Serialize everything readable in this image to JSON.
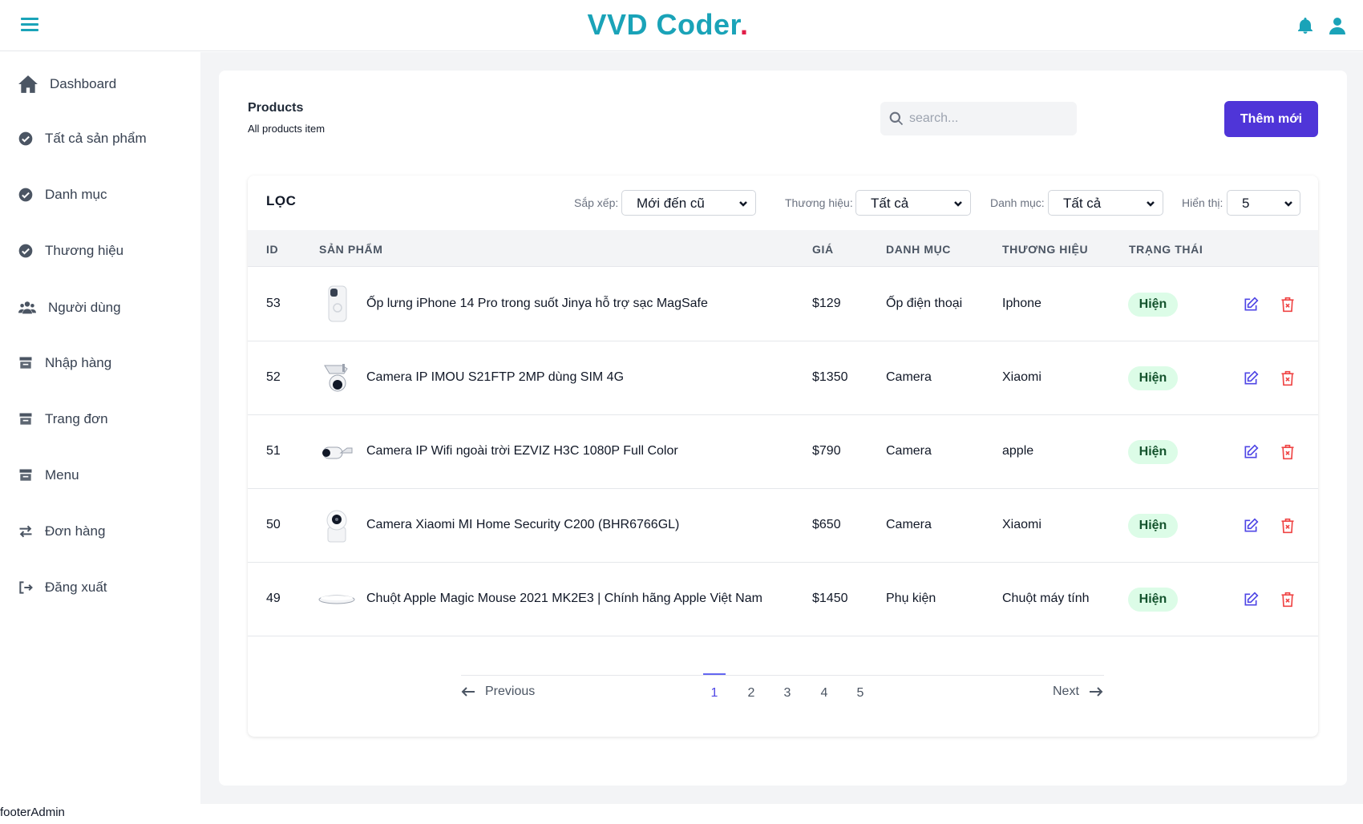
{
  "header": {
    "brand": "VVD Coder",
    "brand_dot": ".",
    "icons": [
      "menu-icon",
      "bell-icon",
      "user-icon"
    ]
  },
  "sidebar": {
    "items": [
      {
        "label": "Dashboard",
        "icon": "home-icon"
      },
      {
        "label": "Tất cả sản phẩm",
        "icon": "check-circle-icon"
      },
      {
        "label": "Danh mục",
        "icon": "check-circle-icon"
      },
      {
        "label": "Thương hiệu",
        "icon": "check-circle-icon"
      },
      {
        "label": "Người dùng",
        "icon": "users-icon"
      },
      {
        "label": "Nhập hàng",
        "icon": "store-icon"
      },
      {
        "label": "Trang đơn",
        "icon": "store-icon"
      },
      {
        "label": "Menu",
        "icon": "store-icon"
      },
      {
        "label": "Đơn hàng",
        "icon": "exchange-icon"
      },
      {
        "label": "Đăng xuất",
        "icon": "logout-icon"
      }
    ]
  },
  "page": {
    "title": "Products",
    "subtitle": "All products item",
    "search_placeholder": "search...",
    "add_button": "Thêm mới"
  },
  "filters": {
    "title": "LỌC",
    "sort_label": "Sắp xếp:",
    "sort_value": "Mới đến cũ",
    "brand_label": "Thương hiệu:",
    "brand_value": "Tất cả",
    "category_label": "Danh mục:",
    "category_value": "Tất cả",
    "show_label": "Hiển thị:",
    "show_value": "5"
  },
  "table": {
    "columns": [
      "ID",
      "SẢN PHẨM",
      "GIÁ",
      "DANH MỤC",
      "THƯƠNG HIỆU",
      "TRẠNG THÁI"
    ],
    "rows": [
      {
        "id": "53",
        "name": "Ốp lưng iPhone 14 Pro trong suốt Jinya hỗ trợ sạc MagSafe",
        "price": "$129",
        "category": "Ốp điện thoại",
        "brand": "Iphone",
        "status": "Hiện",
        "thumb": "phone-case"
      },
      {
        "id": "52",
        "name": "Camera IP IMOU S21FTP 2MP dùng SIM 4G",
        "price": "$1350",
        "category": "Camera",
        "brand": "Xiaomi",
        "status": "Hiện",
        "thumb": "outdoor-camera"
      },
      {
        "id": "51",
        "name": "Camera IP Wifi ngoài trời EZVIZ H3C 1080P Full Color",
        "price": "$790",
        "category": "Camera",
        "brand": "apple",
        "status": "Hiện",
        "thumb": "bullet-camera"
      },
      {
        "id": "50",
        "name": "Camera Xiaomi MI Home Security C200 (BHR6766GL)",
        "price": "$650",
        "category": "Camera",
        "brand": "Xiaomi",
        "status": "Hiện",
        "thumb": "home-camera"
      },
      {
        "id": "49",
        "name": "Chuột Apple Magic Mouse 2021 MK2E3 | Chính hãng Apple Việt Nam",
        "price": "$1450",
        "category": "Phụ kiện",
        "brand": "Chuột máy tính",
        "status": "Hiện",
        "thumb": "mouse"
      }
    ]
  },
  "pagination": {
    "previous": "Previous",
    "next": "Next",
    "pages": [
      "1",
      "2",
      "3",
      "4",
      "5"
    ],
    "current": "1"
  },
  "footer": {
    "text": "footerAdmin"
  },
  "colors": {
    "brand": "#1aa3b8",
    "brand_dot": "#e11d48",
    "primary_button": "#4f35d8",
    "status_bg": "#dcfce7",
    "edit_icon": "#4f46e5",
    "delete_icon": "#ef4444"
  }
}
